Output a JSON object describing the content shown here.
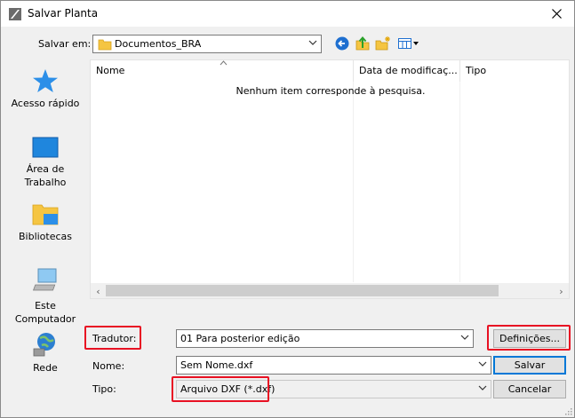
{
  "window": {
    "title": "Salvar Planta"
  },
  "save_in": {
    "label": "Salvar em:",
    "value": "Documentos_BRA"
  },
  "places": [
    {
      "label": "Acesso rápido",
      "icon": "quick-access-star-icon"
    },
    {
      "label": "Área de Trabalho",
      "icon": "desktop-icon"
    },
    {
      "label": "Bibliotecas",
      "icon": "libraries-folder-icon"
    },
    {
      "label": "Este Computador",
      "icon": "computer-icon"
    },
    {
      "label": "Rede",
      "icon": "network-globe-icon"
    }
  ],
  "file_list": {
    "columns": [
      "Nome",
      "Data de modificaç...",
      "Tipo"
    ],
    "empty_message": "Nenhum item corresponde à pesquisa."
  },
  "translator": {
    "label": "Tradutor:",
    "value": "01 Para posterior edição",
    "settings_button": "Definições..."
  },
  "filename": {
    "label": "Nome:",
    "value": "Sem Nome.dxf",
    "save_button": "Salvar"
  },
  "filetype": {
    "label": "Tipo:",
    "value": "Arquivo DXF (*.dxf)",
    "cancel_button": "Cancelar"
  },
  "colors": {
    "highlight": "#e81123",
    "default_button_border": "#0078d7",
    "folder": "#f5c542"
  }
}
